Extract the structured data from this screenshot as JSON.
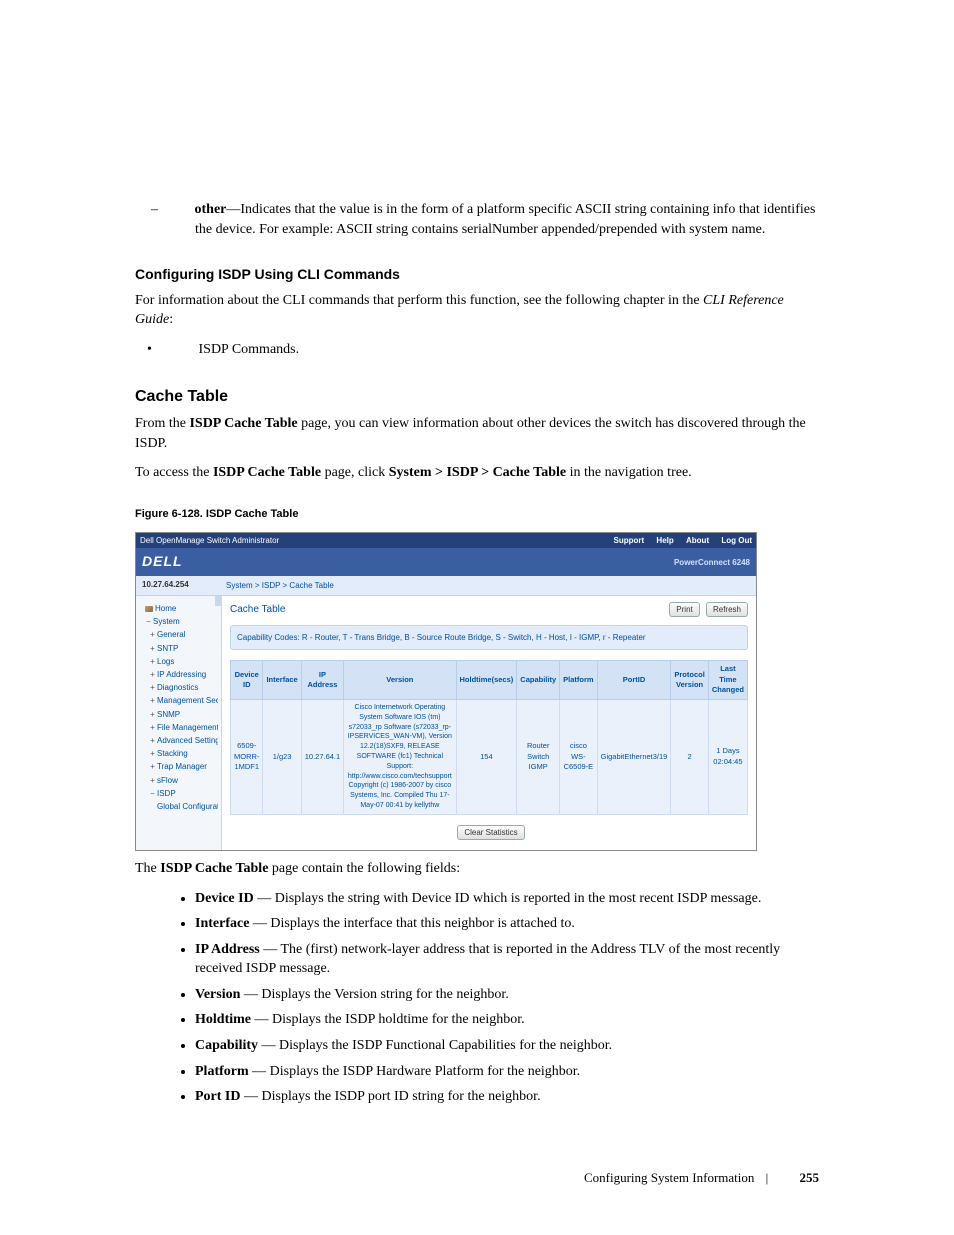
{
  "top_sub_item": {
    "lead": "other",
    "text": "—Indicates that the value is in the form of a platform specific ASCII string containing info that identifies the device. For example: ASCII string contains serialNumber appended/prepended with system name."
  },
  "cli_heading": "Configuring ISDP Using CLI Commands",
  "cli_para_a": "For information about the CLI commands that perform this function, see the following chapter in the ",
  "cli_para_b": "CLI Reference Guide",
  "cli_para_c": ":",
  "cli_bullet": "ISDP Commands.",
  "sect_heading": "Cache Table",
  "sect_p1_a": "From the ",
  "sect_p1_b": "ISDP Cache Table",
  "sect_p1_c": " page, you can view information about other devices the switch has discovered through the ISDP.",
  "sect_p2_a": "To access the ",
  "sect_p2_b": "ISDP Cache Table",
  "sect_p2_c": " page, click ",
  "sect_p2_d": "System > ISDP > Cache Table",
  "sect_p2_e": " in the navigation tree.",
  "figure_caption": "Figure 6-128.    ISDP Cache Table",
  "fig": {
    "app_title": "Dell OpenManage Switch Administrator",
    "top_links": {
      "support": "Support",
      "help": "Help",
      "about": "About",
      "logout": "Log Out"
    },
    "brand": "DELL",
    "product": "PowerConnect 6248",
    "ip": "10.27.64.254",
    "breadcrumb": "System > ISDP > Cache Table",
    "nav": [
      {
        "lvl": "l0",
        "exp": "",
        "icon": true,
        "label": "Home"
      },
      {
        "lvl": "l0",
        "exp": "−",
        "label": "System"
      },
      {
        "lvl": "l1",
        "exp": "+",
        "label": "General"
      },
      {
        "lvl": "l1",
        "exp": "+",
        "label": "SNTP"
      },
      {
        "lvl": "l1",
        "exp": "+",
        "label": "Logs"
      },
      {
        "lvl": "l1",
        "exp": "+",
        "label": "IP Addressing"
      },
      {
        "lvl": "l1",
        "exp": "+",
        "label": "Diagnostics"
      },
      {
        "lvl": "l1",
        "exp": "+",
        "label": "Management Secur"
      },
      {
        "lvl": "l1",
        "exp": "+",
        "label": "SNMP"
      },
      {
        "lvl": "l1",
        "exp": "+",
        "label": "File Management"
      },
      {
        "lvl": "l1",
        "exp": "+",
        "label": "Advanced Settings"
      },
      {
        "lvl": "l1",
        "exp": "+",
        "label": "Stacking"
      },
      {
        "lvl": "l1",
        "exp": "+",
        "label": "Trap Manager"
      },
      {
        "lvl": "l1",
        "exp": "+",
        "label": "sFlow"
      },
      {
        "lvl": "l1",
        "exp": "−",
        "label": "ISDP"
      },
      {
        "lvl": "l2",
        "exp": "",
        "label": "Global Configurat"
      }
    ],
    "main_title": "Cache Table",
    "btn_print": "Print",
    "btn_refresh": "Refresh",
    "capcodes": "Capability Codes: R - Router, T - Trans Bridge, B - Source Route Bridge, S - Switch, H - Host, I - IGMP, r - Repeater",
    "headers": [
      "Device ID",
      "Interface",
      "IP Address",
      "Version",
      "Holdtime(secs)",
      "Capability",
      "Platform",
      "PortID",
      "Protocol Version",
      "Last Time Changed"
    ],
    "row": {
      "device_id": "6509-MORR-1MDF1",
      "interface": "1/g23",
      "ip": "10.27.64.1",
      "version": "Cisco Internetwork Operating System Software IOS (tm) s72033_rp Software (s72033_rp-IPSERVICES_WAN-VM), Version 12.2(18)SXF9, RELEASE SOFTWARE (fc1) Technical Support: http://www.cisco.com/techsupport Copyright (c) 1986-2007 by cisco Systems, Inc. Compiled Thu 17-May-07 00:41 by kellythw",
      "holdtime": "154",
      "capability": "Router Switch IGMP",
      "platform": "cisco WS-C6509-E",
      "portid": "GigabitEthernet3/19",
      "protover": "2",
      "lastchg": "1 Days 02:04:45"
    },
    "btn_clear": "Clear Statistics"
  },
  "after_fig_a": "The ",
  "after_fig_b": "ISDP Cache Table",
  "after_fig_c": " page contain the following fields:",
  "fields": [
    {
      "name": "Device ID",
      "desc": " — Displays the string with Device ID which is reported in the most recent ISDP message."
    },
    {
      "name": "Interface",
      "desc": " — Displays the interface that this neighbor is attached to."
    },
    {
      "name": "IP Address",
      "desc": " — The (first) network-layer address that is reported in the Address TLV of the most recently received ISDP message."
    },
    {
      "name": "Version",
      "desc": " — Displays the Version string for the neighbor."
    },
    {
      "name": "Holdtime",
      "desc": " — Displays the ISDP holdtime for the neighbor."
    },
    {
      "name": "Capability",
      "desc": " — Displays the ISDP Functional Capabilities for the neighbor."
    },
    {
      "name": "Platform",
      "desc": " — Displays the ISDP Hardware Platform for the neighbor."
    },
    {
      "name": "Port ID",
      "desc": " — Displays the ISDP port ID string for the neighbor."
    }
  ],
  "footer_section": "Configuring System Information",
  "footer_page": "255"
}
